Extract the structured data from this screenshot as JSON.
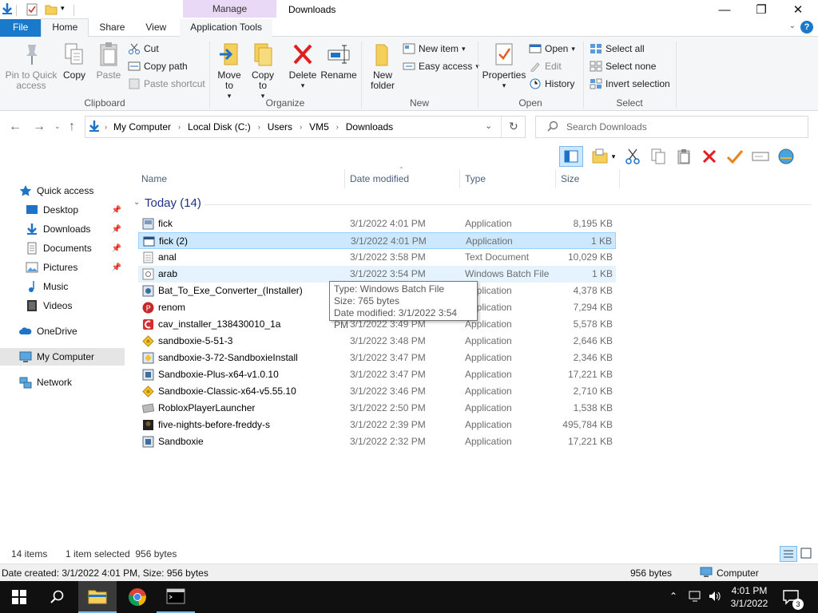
{
  "window": {
    "title": "Downloads",
    "context_tab": "Manage"
  },
  "tabs": {
    "file": "File",
    "home": "Home",
    "share": "Share",
    "view": "View",
    "app_tools": "Application Tools"
  },
  "ribbon": {
    "clipboard": {
      "pin": "Pin to Quick access",
      "copy": "Copy",
      "paste": "Paste",
      "cut": "Cut",
      "copy_path": "Copy path",
      "paste_shortcut": "Paste shortcut",
      "label": "Clipboard"
    },
    "organize": {
      "move_to": "Move to",
      "copy_to": "Copy to",
      "delete": "Delete",
      "rename": "Rename",
      "label": "Organize"
    },
    "new": {
      "new_folder": "New folder",
      "new_item": "New item",
      "easy_access": "Easy access",
      "label": "New"
    },
    "open": {
      "properties": "Properties",
      "open": "Open",
      "edit": "Edit",
      "history": "History",
      "label": "Open"
    },
    "select": {
      "select_all": "Select all",
      "select_none": "Select none",
      "invert": "Invert selection",
      "label": "Select"
    }
  },
  "address": {
    "crumbs": [
      "My Computer",
      "Local Disk (C:)",
      "Users",
      "VM5",
      "Downloads"
    ],
    "search_placeholder": "Search Downloads"
  },
  "sidebar": {
    "quick_access": "Quick access",
    "items": [
      "Desktop",
      "Downloads",
      "Documents",
      "Pictures",
      "Music",
      "Videos"
    ],
    "onedrive": "OneDrive",
    "my_computer": "My Computer",
    "network": "Network"
  },
  "columns": {
    "name": "Name",
    "date": "Date modified",
    "type": "Type",
    "size": "Size"
  },
  "group": "Today (14)",
  "files": [
    {
      "name": "fick",
      "date": "3/1/2022 4:01 PM",
      "type": "Application",
      "size": "8,195 KB"
    },
    {
      "name": "fick (2)",
      "date": "3/1/2022 4:01 PM",
      "type": "Application",
      "size": "1 KB"
    },
    {
      "name": "anal",
      "date": "3/1/2022 3:58 PM",
      "type": "Text Document",
      "size": "10,029 KB"
    },
    {
      "name": "arab",
      "date": "3/1/2022 3:54 PM",
      "type": "Windows Batch File",
      "size": "1 KB"
    },
    {
      "name": "Bat_To_Exe_Converter_(Installer)",
      "date": "3/1/2022 3:5",
      "type": "Application",
      "size": "4,378 KB"
    },
    {
      "name": "renom",
      "date": "3/1/2022 3:5",
      "type": "Application",
      "size": "7,294 KB"
    },
    {
      "name": "cav_installer_138430010_1a",
      "date": "3/1/2022 3:49 PM",
      "type": "Application",
      "size": "5,578 KB"
    },
    {
      "name": "sandboxie-5-51-3",
      "date": "3/1/2022 3:48 PM",
      "type": "Application",
      "size": "2,646 KB"
    },
    {
      "name": "sandboxie-3-72-SandboxieInstall",
      "date": "3/1/2022 3:47 PM",
      "type": "Application",
      "size": "2,346 KB"
    },
    {
      "name": "Sandboxie-Plus-x64-v1.0.10",
      "date": "3/1/2022 3:47 PM",
      "type": "Application",
      "size": "17,221 KB"
    },
    {
      "name": "Sandboxie-Classic-x64-v5.55.10",
      "date": "3/1/2022 3:46 PM",
      "type": "Application",
      "size": "2,710 KB"
    },
    {
      "name": "RobloxPlayerLauncher",
      "date": "3/1/2022 2:50 PM",
      "type": "Application",
      "size": "1,538 KB"
    },
    {
      "name": "five-nights-before-freddy-s",
      "date": "3/1/2022 2:39 PM",
      "type": "Application",
      "size": "495,784 KB"
    },
    {
      "name": "Sandboxie",
      "date": "3/1/2022 2:32 PM",
      "type": "Application",
      "size": "17,221 KB"
    }
  ],
  "tooltip": {
    "type": "Type: Windows Batch File",
    "size": "Size: 765 bytes",
    "date": "Date modified: 3/1/2022 3:54 PM"
  },
  "status": {
    "count": "14 items",
    "selected": "1 item selected  956 bytes"
  },
  "details": {
    "created": "Date created: 3/1/2022 4:01 PM, Size: 956 bytes",
    "bytes": "956 bytes",
    "computer": "Computer"
  },
  "taskbar": {
    "time": "4:01 PM",
    "date": "3/1/2022",
    "notif_count": "3"
  }
}
